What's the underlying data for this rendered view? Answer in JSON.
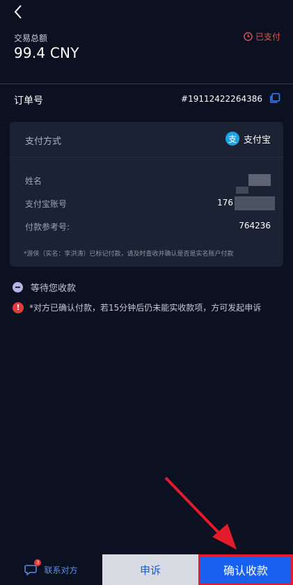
{
  "header": {
    "total_label": "交易总额",
    "total_amount": "99.4 CNY",
    "status_text": "已支付"
  },
  "order": {
    "label": "订单号",
    "number": "#19112422264386"
  },
  "payment": {
    "method_label": "支付方式",
    "method_name": "支付宝",
    "method_logo_char": "支",
    "name_label": "姓名",
    "account_label": "支付宝账号",
    "account_value_visible": "176",
    "reference_label": "付款参考号:",
    "reference_value": "764236",
    "note": "*游侠（实名：李洪涛）已标记付款，请及时查收并确认是否是实名账户付款"
  },
  "status_messages": {
    "waiting": "等待您收款",
    "warning": "*对方已确认付款，若15分钟后仍未能实收款项，方可发起申诉",
    "warning_icon_char": "!"
  },
  "bottom_bar": {
    "contact_label": "联系对方",
    "contact_badge": "3",
    "appeal_label": "申诉",
    "confirm_label": "确认收款"
  },
  "icons": {
    "back": "back-arrow-icon",
    "status": "clock-icon",
    "copy": "copy-icon",
    "alipay": "alipay-logo-icon",
    "waiting": "minus-circle-icon",
    "warning": "exclamation-icon",
    "chat": "chat-icon"
  },
  "colors": {
    "background": "#0b1120",
    "card": "#1a2233",
    "status_red": "#e0554f",
    "accent_blue": "#1860f0",
    "link_blue": "#5b8dee",
    "annotation_red": "#e31b2a"
  }
}
